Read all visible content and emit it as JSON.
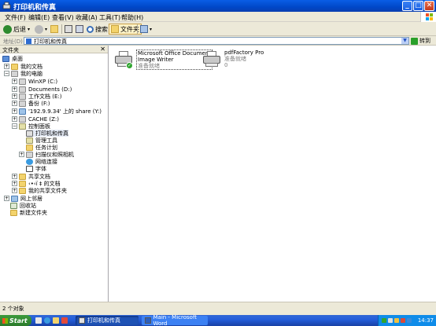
{
  "window": {
    "title": "打印机和传真"
  },
  "menu": [
    "文件(F)",
    "编辑(E)",
    "查看(V)",
    "收藏(A)",
    "工具(T)",
    "帮助(H)"
  ],
  "toolbar": {
    "back": "后退",
    "search": "搜索",
    "folders": "文件夹"
  },
  "address": {
    "label": "地址(D)",
    "value": "打印机和传真",
    "go": "转到"
  },
  "folders_pane": {
    "title": "文件夹",
    "items": [
      {
        "label": "桌面",
        "icon": "desktop-icon"
      },
      {
        "label": "我的文档",
        "icon": "folder-icon"
      },
      {
        "label": "我的电脑",
        "icon": "computer-icon"
      },
      {
        "label": "WinXP (C:)",
        "icon": "drive-icon"
      },
      {
        "label": "Documents (D:)",
        "icon": "drive-icon"
      },
      {
        "label": "工作文档 (E:)",
        "icon": "drive-icon"
      },
      {
        "label": "备份 (F:)",
        "icon": "drive-icon"
      },
      {
        "label": "'192.9.9.34' 上的 share (Y:)",
        "icon": "network-drive-icon"
      },
      {
        "label": "CACHE (Z:)",
        "icon": "drive-icon"
      },
      {
        "label": "控制面板",
        "icon": "control-panel-icon"
      },
      {
        "label": "打印机和传真",
        "icon": "printer-icon"
      },
      {
        "label": "管理工具",
        "icon": "tools-icon"
      },
      {
        "label": "任务计划",
        "icon": "folder-icon"
      },
      {
        "label": "扫描仪和照相机",
        "icon": "scanner-icon"
      },
      {
        "label": "网络连接",
        "icon": "network-icon"
      },
      {
        "label": "字体",
        "icon": "font-icon"
      },
      {
        "label": "共享文档",
        "icon": "folder-icon"
      },
      {
        "label": "‹•‹ï ‡ 的文档",
        "icon": "folder-icon"
      },
      {
        "label": "我的共享文件夹",
        "icon": "folder-icon"
      },
      {
        "label": "网上邻居",
        "icon": "network-icon"
      },
      {
        "label": "回收站",
        "icon": "recycle-bin-icon"
      },
      {
        "label": "新建文件夹",
        "icon": "folder-icon"
      }
    ]
  },
  "printers": [
    {
      "name_line1": "Microsoft Office Document",
      "name_line2": "Image Writer",
      "status": "准备就绪"
    },
    {
      "name_line1": "pdfFactory Pro",
      "status": "准备就绪",
      "count": "0"
    }
  ],
  "status_bar": "2 个对象",
  "taskbar": {
    "start": "Start",
    "tasks": [
      "打印机和传真",
      "Main - Microsoft Word"
    ],
    "clock": "14:37"
  }
}
